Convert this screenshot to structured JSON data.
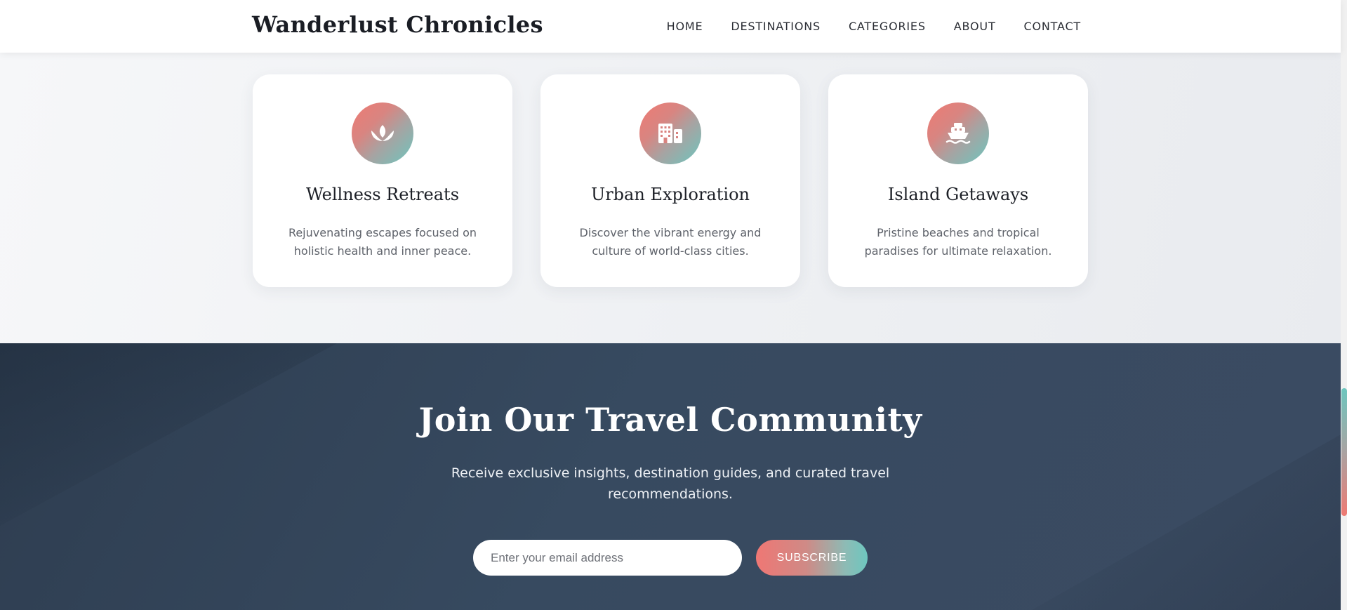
{
  "header": {
    "logo": "Wanderlust Chronicles",
    "nav": [
      "HOME",
      "DESTINATIONS",
      "CATEGORIES",
      "ABOUT",
      "CONTACT"
    ]
  },
  "categories": [
    {
      "icon": "lotus-icon",
      "title": "Wellness Retreats",
      "description": "Rejuvenating escapes focused on holistic health and inner peace."
    },
    {
      "icon": "city-buildings-icon",
      "title": "Urban Exploration",
      "description": "Discover the vibrant energy and culture of world-class cities."
    },
    {
      "icon": "ship-icon",
      "title": "Island Getaways",
      "description": "Pristine beaches and tropical paradises for ultimate relaxation."
    }
  ],
  "newsletter": {
    "title": "Join Our Travel Community",
    "text": "Receive exclusive insights, destination guides, and curated travel recommendations.",
    "email_placeholder": "Enter your email address",
    "subscribe_label": "SUBSCRIBE"
  },
  "colors": {
    "accent_coral": "#ef7a73",
    "accent_teal": "#6cc6be",
    "newsletter_bg": "#374a60",
    "header_bg": "#ffffff"
  }
}
